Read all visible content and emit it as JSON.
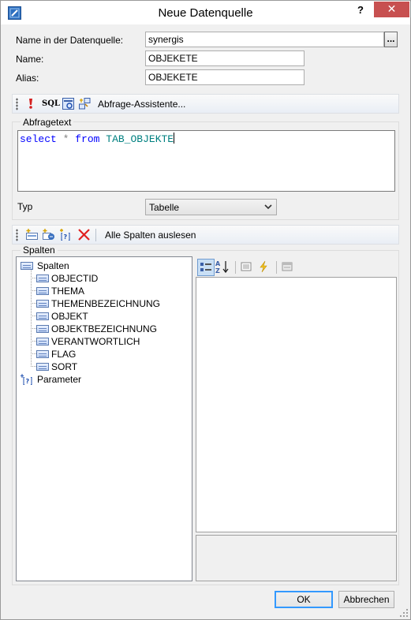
{
  "window": {
    "title": "Neue Datenquelle",
    "help_label": "?",
    "close_label": "✕"
  },
  "form": {
    "name_in_datasource_label": "Name in der Datenquelle:",
    "name_in_datasource_value": "synergis",
    "browse_label": "...",
    "name_label": "Name:",
    "name_value": "OBJEKETE",
    "alias_label": "Alias:",
    "alias_value": "OBJEKETE"
  },
  "query_toolbar": {
    "icons": [
      "exclamation-icon",
      "sql-icon",
      "query-test-icon",
      "query-wizard-icon"
    ],
    "sql_label": "SQL",
    "wizard_label": "Abfrage-Assistente..."
  },
  "query": {
    "group_title": "Abfragetext",
    "tokens": {
      "select": "select",
      "star": "*",
      "from": "from",
      "table": "TAB_OBJEKTE"
    },
    "typ_label": "Typ",
    "typ_value": "Tabelle"
  },
  "columns_toolbar": {
    "icons": [
      "add-column-icon",
      "add-expression-icon",
      "add-parameter-icon",
      "delete-icon"
    ],
    "read_all_label": "Alle Spalten auslesen"
  },
  "columns": {
    "group_title": "Spalten",
    "tree_root": "Spalten",
    "items": [
      "OBJECTID",
      "THEMA",
      "THEMENBEZEICHNUNG",
      "OBJEKT",
      "OBJEKTBEZEICHNUNG",
      "VERANTWORTLICH",
      "FLAG",
      "SORT"
    ],
    "parameter_node": "Parameter"
  },
  "property_toolbar": {
    "buttons": [
      "categorized-icon",
      "alphabetical-icon",
      "properties-icon",
      "events-icon",
      "property-pages-icon"
    ]
  },
  "buttons": {
    "ok": "OK",
    "cancel": "Abbrechen"
  }
}
